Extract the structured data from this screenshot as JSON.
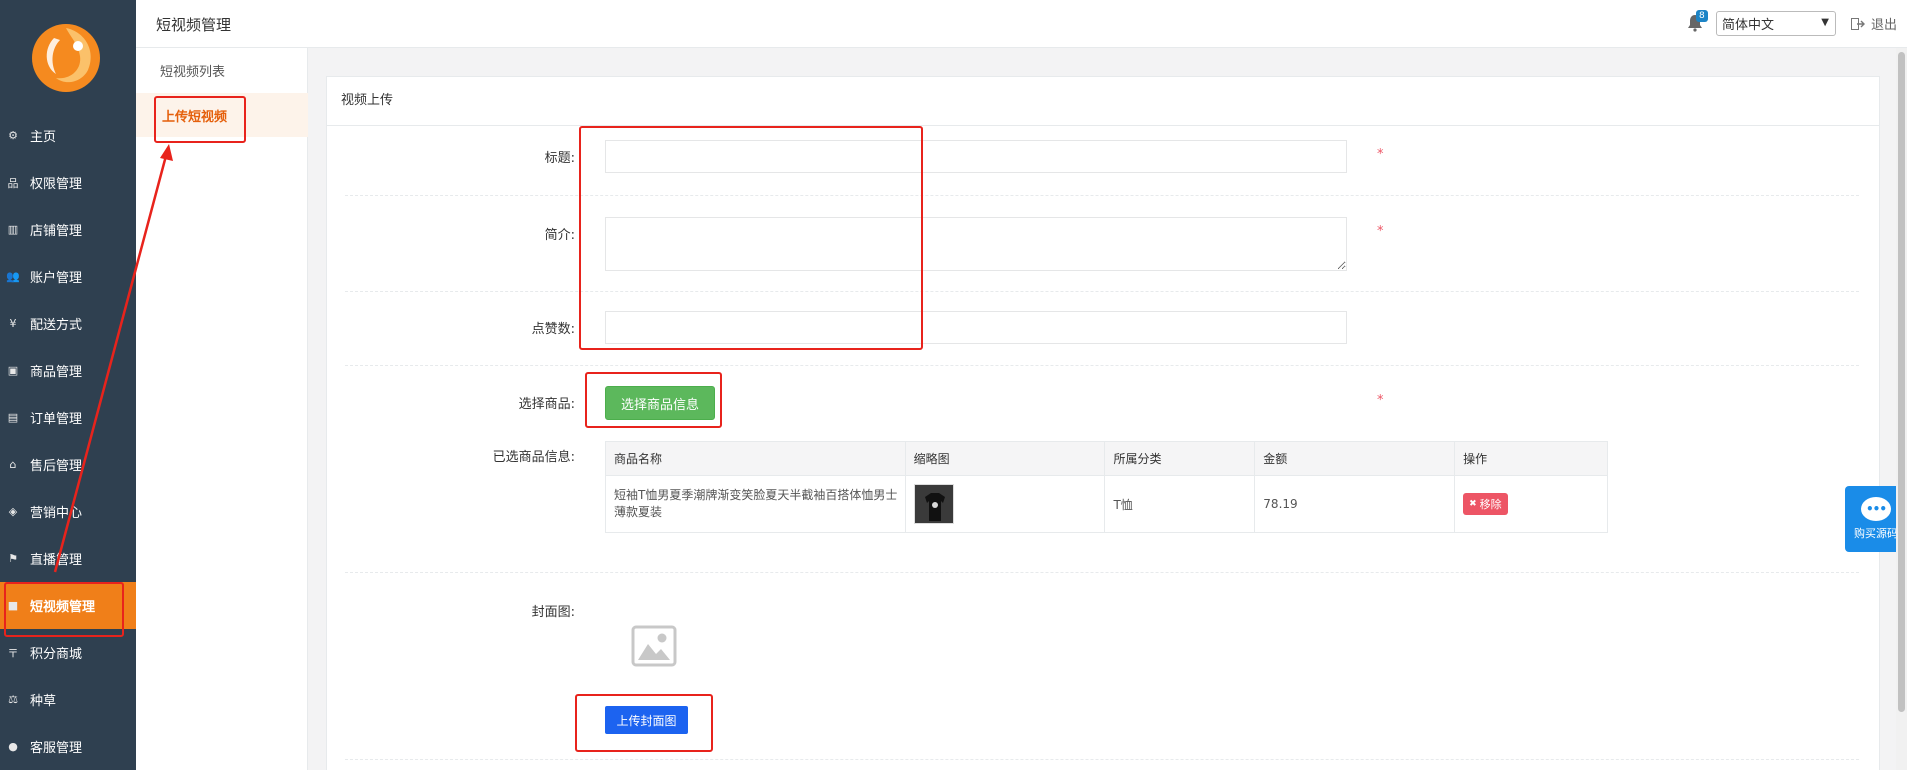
{
  "nav": {
    "items": [
      {
        "label": "主页",
        "icon": "gear-icon",
        "glyph": "⚙"
      },
      {
        "label": "权限管理",
        "icon": "sitemap-icon",
        "glyph": "品"
      },
      {
        "label": "店铺管理",
        "icon": "map-icon",
        "glyph": "▥"
      },
      {
        "label": "账户管理",
        "icon": "users-icon",
        "glyph": "👥"
      },
      {
        "label": "配送方式",
        "icon": "yen-icon",
        "glyph": "¥"
      },
      {
        "label": "商品管理",
        "icon": "image-icon",
        "glyph": "▣"
      },
      {
        "label": "订单管理",
        "icon": "list-alt-icon",
        "glyph": "▤"
      },
      {
        "label": "售后管理",
        "icon": "bank-icon",
        "glyph": "⌂"
      },
      {
        "label": "营销中心",
        "icon": "tag-icon",
        "glyph": "◈"
      },
      {
        "label": "直播管理",
        "icon": "flag-icon",
        "glyph": "⚑"
      },
      {
        "label": "短视频管理",
        "icon": "video-camera-icon",
        "glyph": "■",
        "active": true
      },
      {
        "label": "积分商城",
        "icon": "rmb-icon",
        "glyph": "〒"
      },
      {
        "label": "种草",
        "icon": "balance-scale-icon",
        "glyph": "⚖"
      },
      {
        "label": "客服管理",
        "icon": "comment-icon",
        "glyph": "●"
      }
    ]
  },
  "subnav": {
    "items": [
      {
        "label": "短视频列表"
      },
      {
        "label": "上传短视频",
        "active": true
      }
    ]
  },
  "header": {
    "title": "短视频管理",
    "notification_count": "8",
    "language": "简体中文",
    "logout_label": "退出"
  },
  "form": {
    "panel_title": "视频上传",
    "title_label": "标题:",
    "title_value": "",
    "intro_label": "简介:",
    "intro_value": "",
    "likes_label": "点赞数:",
    "likes_value": "",
    "required_mark": "*",
    "select_goods_label": "选择商品:",
    "select_goods_button": "选择商品信息",
    "selected_goods_label": "已选商品信息:",
    "cover_label": "封面图:",
    "upload_cover_button": "上传封面图"
  },
  "goods_table": {
    "headers": [
      "商品名称",
      "缩略图",
      "所属分类",
      "金额",
      "操作"
    ],
    "rows": [
      {
        "name": "短袖T恤男夏季潮牌渐变笑脸夏天半截袖百搭体恤男士薄款夏装",
        "category": "T恤",
        "amount": "78.19",
        "action": "移除"
      }
    ]
  },
  "float_button": {
    "label": "购买源码",
    "icon_text": "•••"
  },
  "colors": {
    "nav_bg": "#2f4050",
    "active_orange": "#f07f19",
    "annotation_red": "#e8231c",
    "green_button": "#5cb85c",
    "blue_button": "#1c63f0",
    "remove_red": "#ed5565"
  }
}
